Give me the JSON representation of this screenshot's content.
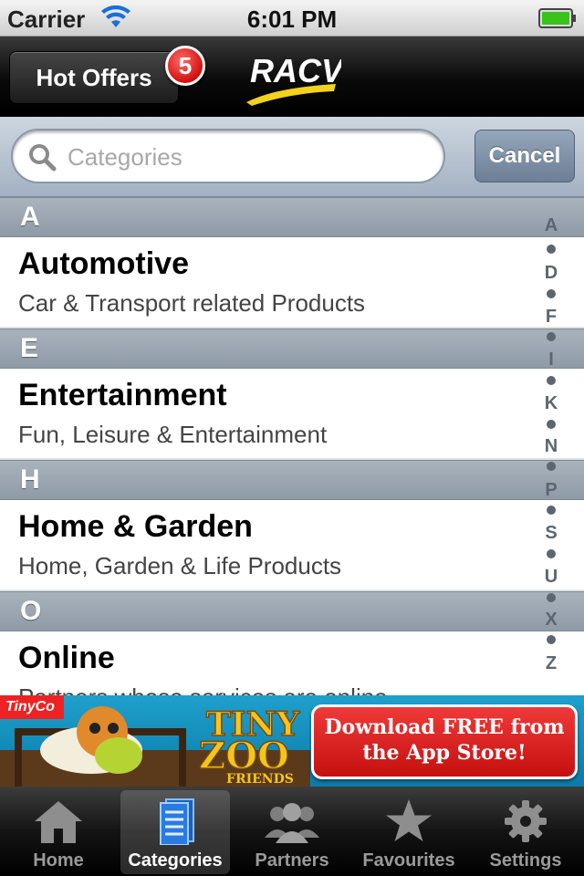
{
  "status_bar": {
    "carrier": "Carrier",
    "time": "6:01 PM"
  },
  "nav_bar": {
    "hot_offers_label": "Hot Offers",
    "badge_count": "5",
    "logo_text": "RACV"
  },
  "search": {
    "placeholder": "Categories",
    "cancel_label": "Cancel"
  },
  "sections": [
    {
      "letter": "A",
      "title": "Automotive",
      "subtitle": "Car & Transport related Products"
    },
    {
      "letter": "E",
      "title": "Entertainment",
      "subtitle": "Fun, Leisure & Entertainment"
    },
    {
      "letter": "H",
      "title": "Home & Garden",
      "subtitle": "Home, Garden & Life Products"
    },
    {
      "letter": "O",
      "title": "Online",
      "subtitle": "Partners whose services are online"
    }
  ],
  "index_letters": [
    "A",
    "D",
    "F",
    "I",
    "K",
    "N",
    "P",
    "S",
    "U",
    "X",
    "Z"
  ],
  "ad": {
    "brand_tag": "TinyCo",
    "game_title_1": "TINY",
    "game_title_2": "ZOO",
    "game_title_3": "FRIENDS",
    "cta_line1": "Download FREE from",
    "cta_line2": "the App Store!"
  },
  "tabs": [
    {
      "label": "Home",
      "icon": "home-icon",
      "selected": false
    },
    {
      "label": "Categories",
      "icon": "categories-icon",
      "selected": true
    },
    {
      "label": "Partners",
      "icon": "partners-icon",
      "selected": false
    },
    {
      "label": "Favourites",
      "icon": "star-icon",
      "selected": false
    },
    {
      "label": "Settings",
      "icon": "gear-icon",
      "selected": false
    }
  ],
  "colors": {
    "badge": "#d40f0f",
    "ad_button": "#d42020",
    "racv_yellow": "#f2d21b"
  }
}
